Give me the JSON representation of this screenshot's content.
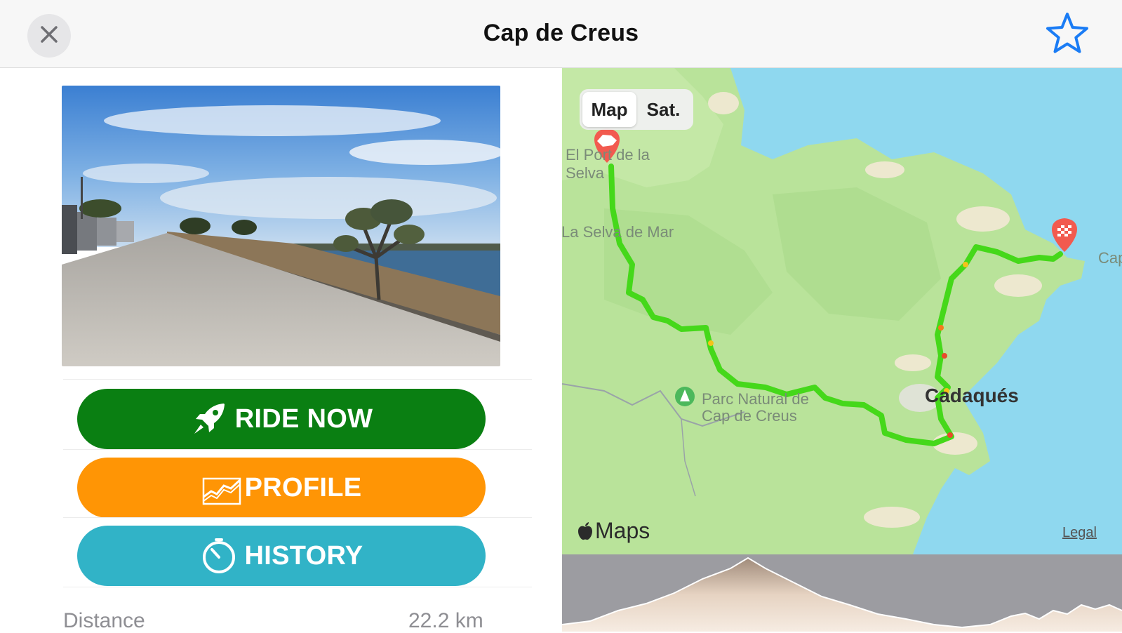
{
  "header": {
    "title": "Cap de Creus"
  },
  "icons": {
    "close": "close-icon",
    "favorite": "star-icon",
    "ride": "rocket-icon",
    "profile": "chart-icon",
    "history": "stopwatch-icon"
  },
  "colors": {
    "ride_now": "#0a7f12",
    "profile": "#ff9505",
    "history": "#31b3c7",
    "star": "#1a7cf5",
    "route": "#45d81a"
  },
  "actions": {
    "ride_now": "RIDE NOW",
    "profile": "PROFILE",
    "history": "HISTORY"
  },
  "stats": {
    "distance_label": "Distance",
    "distance_value": "22.2 km"
  },
  "map": {
    "modes": [
      "Map",
      "Sat."
    ],
    "selected_mode": "Map",
    "labels": {
      "start_town": "El Port de la Selva",
      "village": "La Selva de Mar",
      "park": "Parc Natural de Cap de Creus",
      "town": "Cadaqués",
      "cape": "Cap"
    },
    "attribution": "Maps",
    "legal": "Legal"
  }
}
